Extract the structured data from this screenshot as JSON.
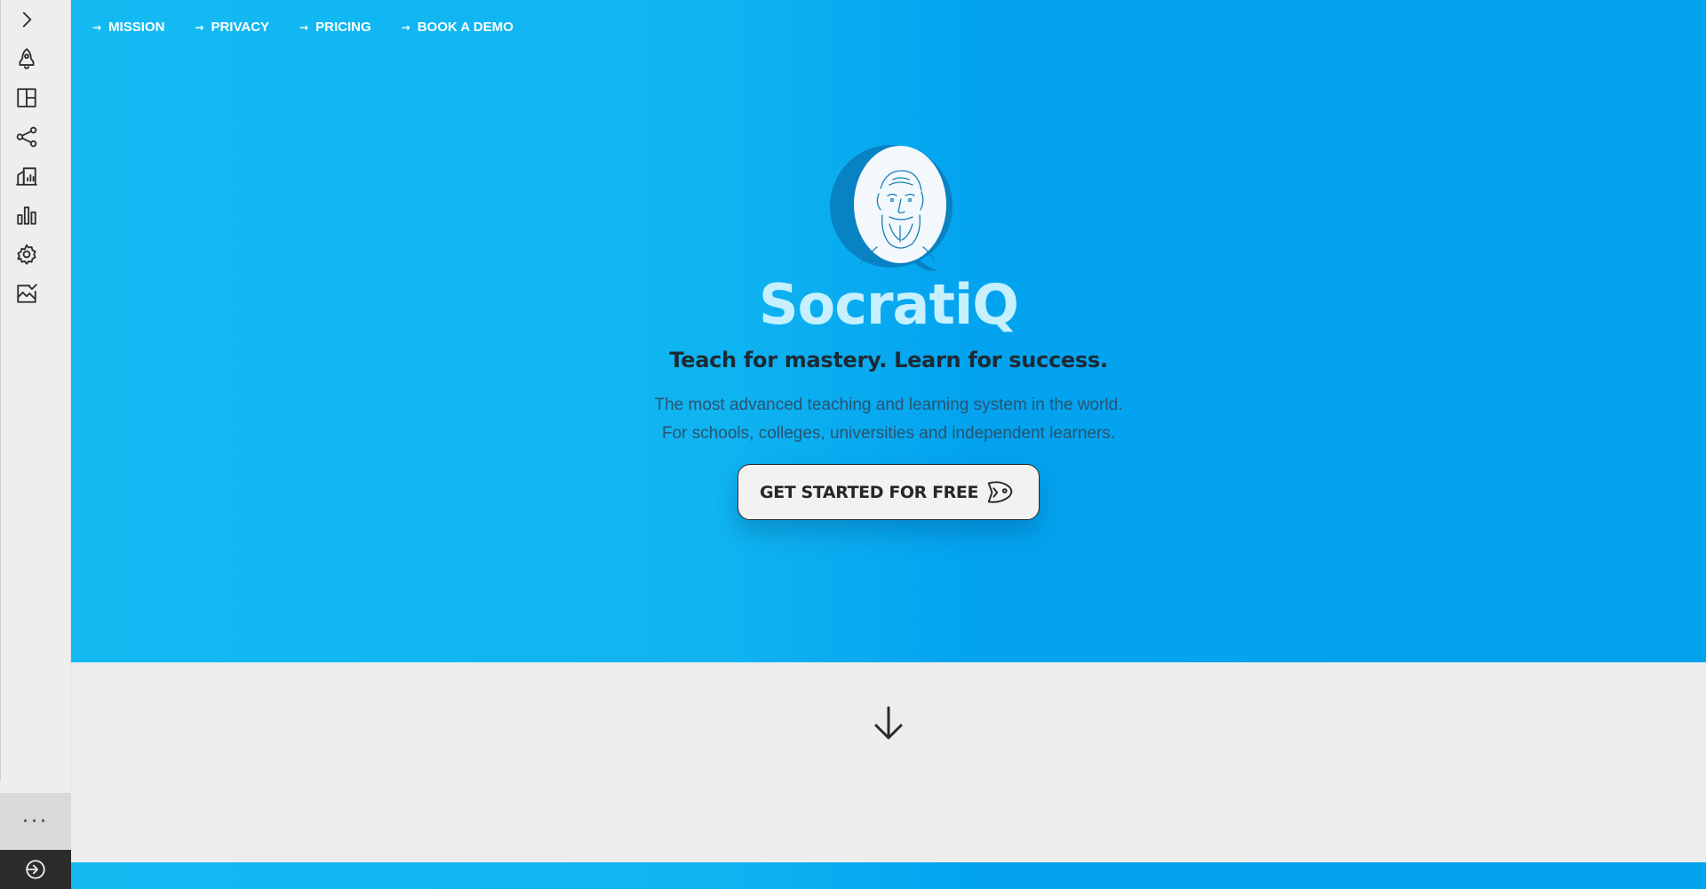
{
  "nav": {
    "items": [
      {
        "label": "MISSION"
      },
      {
        "label": "PRIVACY"
      },
      {
        "label": "PRICING"
      },
      {
        "label": "BOOK A DEMO"
      }
    ],
    "arrow": "→"
  },
  "sidebar": {
    "icons": [
      "chevron-right-icon",
      "rocket-icon",
      "layout-icon",
      "share-icon",
      "building-chart-icon",
      "bar-chart-icon",
      "gear-icon",
      "image-check-icon"
    ],
    "more_label": "···",
    "exit_icon": "login-icon"
  },
  "hero": {
    "brand": "SocratiQ",
    "tagline": "Teach for mastery. Learn for success.",
    "desc_line1": "The most advanced teaching and learning system in the world.",
    "desc_line2": "For schools, colleges, universities and independent learners.",
    "cta_label": "GET STARTED FOR FREE",
    "cta_icon": "rocket-fish-icon"
  },
  "lower": {
    "scroll_icon": "arrow-down-icon"
  },
  "colors": {
    "hero_blue": "#0fb4f1",
    "hero_blue_dark": "#03a2ee",
    "brand_text": "#c7f0ff",
    "logo_blue": "#0782c2",
    "sidebar_bg": "#eeeeee",
    "exit_bg": "#2b2b2b"
  }
}
